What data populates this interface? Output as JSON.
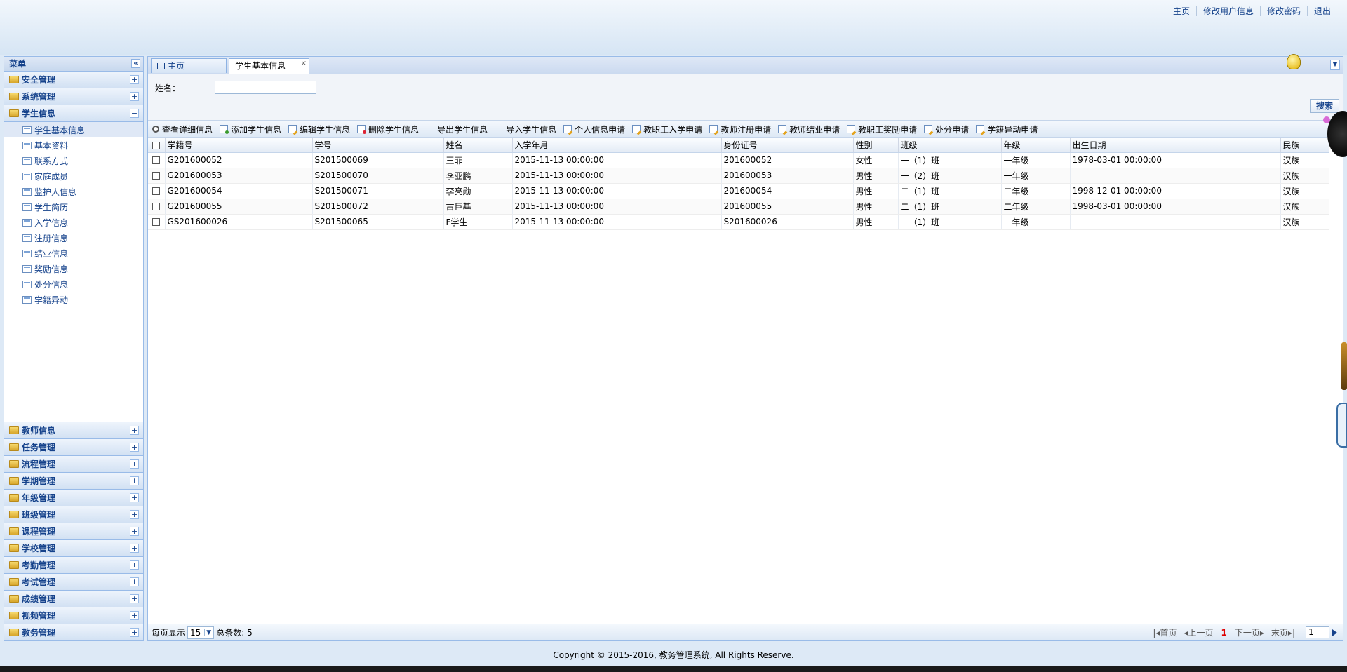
{
  "top_nav": [
    "主页",
    "修改用户信息",
    "修改密码",
    "退出"
  ],
  "sidebar": {
    "title": "菜单",
    "sections_top": [
      {
        "label": "安全管理",
        "toggle": "+"
      },
      {
        "label": "系统管理",
        "toggle": "+"
      },
      {
        "label": "学生信息",
        "toggle": "−"
      }
    ],
    "tree_items": [
      "学生基本信息",
      "基本资料",
      "联系方式",
      "家庭成员",
      "监护人信息",
      "学生简历",
      "入学信息",
      "注册信息",
      "结业信息",
      "奖励信息",
      "处分信息",
      "学籍异动"
    ],
    "sections_bottom": [
      {
        "label": "教师信息",
        "toggle": "+"
      },
      {
        "label": "任务管理",
        "toggle": "+"
      },
      {
        "label": "流程管理",
        "toggle": "+"
      },
      {
        "label": "学期管理",
        "toggle": "+"
      },
      {
        "label": "年级管理",
        "toggle": "+"
      },
      {
        "label": "班级管理",
        "toggle": "+"
      },
      {
        "label": "课程管理",
        "toggle": "+"
      },
      {
        "label": "学校管理",
        "toggle": "+"
      },
      {
        "label": "考勤管理",
        "toggle": "+"
      },
      {
        "label": "考试管理",
        "toggle": "+"
      },
      {
        "label": "成绩管理",
        "toggle": "+"
      },
      {
        "label": "视频管理",
        "toggle": "+"
      },
      {
        "label": "教务管理",
        "toggle": "+"
      }
    ]
  },
  "tabs": {
    "home": "主页",
    "active": "学生基本信息",
    "close": "×"
  },
  "search": {
    "name_label": "姓名：",
    "name_value": "",
    "button": "搜索"
  },
  "toolbar": [
    {
      "label": "查看详细信息",
      "icon": "magnifier-icon"
    },
    {
      "label": "添加学生信息",
      "icon": "add-icon"
    },
    {
      "label": "编辑学生信息",
      "icon": "edit-icon"
    },
    {
      "label": "删除学生信息",
      "icon": "delete-icon"
    },
    {
      "label": "导出学生信息",
      "icon": "none"
    },
    {
      "label": "导入学生信息",
      "icon": "none"
    },
    {
      "label": "个人信息申请",
      "icon": "edit-icon"
    },
    {
      "label": "教职工入学申请",
      "icon": "edit-icon"
    },
    {
      "label": "教师注册申请",
      "icon": "edit-icon"
    },
    {
      "label": "教师结业申请",
      "icon": "edit-icon"
    },
    {
      "label": "教职工奖励申请",
      "icon": "edit-icon"
    },
    {
      "label": "处分申请",
      "icon": "edit-icon"
    },
    {
      "label": "学籍异动申请",
      "icon": "edit-icon"
    }
  ],
  "grid": {
    "columns": [
      "学籍号",
      "学号",
      "姓名",
      "入学年月",
      "身份证号",
      "性别",
      "班级",
      "年级",
      "出生日期",
      "民族"
    ],
    "rows": [
      [
        "G201600052",
        "S201500069",
        "王菲",
        "2015-11-13 00:00:00",
        "201600052",
        "女性",
        "一（1）班",
        "一年级",
        "1978-03-01 00:00:00",
        "汉族"
      ],
      [
        "G201600053",
        "S201500070",
        "李亚鹏",
        "2015-11-13 00:00:00",
        "201600053",
        "男性",
        "一（2）班",
        "一年级",
        "",
        "汉族"
      ],
      [
        "G201600054",
        "S201500071",
        "李亮勋",
        "2015-11-13 00:00:00",
        "201600054",
        "男性",
        "二（1）班",
        "二年级",
        "1998-12-01 00:00:00",
        "汉族"
      ],
      [
        "G201600055",
        "S201500072",
        "古巨基",
        "2015-11-13 00:00:00",
        "201600055",
        "男性",
        "二（1）班",
        "二年级",
        "1998-03-01 00:00:00",
        "汉族"
      ],
      [
        "GS201600026",
        "S201500065",
        "F学生",
        "2015-11-13 00:00:00",
        "S201600026",
        "男性",
        "一（1）班",
        "一年级",
        "",
        "汉族"
      ]
    ]
  },
  "pager": {
    "per_page_label": "每页显示",
    "per_page": "15",
    "total_label": "总条数: 5",
    "first": "首页",
    "prev": "上一页",
    "current": "1",
    "next": "下一页",
    "last": "末页",
    "page_input": "1"
  },
  "footer": "Copyright © 2015-2016, 教务管理系统, All Rights Reserve."
}
